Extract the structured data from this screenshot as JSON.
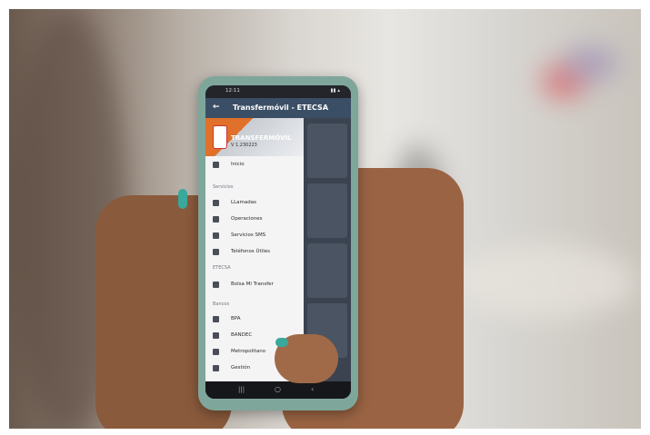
{
  "status_bar": {
    "time": "12:11"
  },
  "app_bar": {
    "title": "Transfermóvil - ETECSA"
  },
  "drawer": {
    "brand": "TRANSFERMÓVIL",
    "version": "V 1.230223",
    "items": {
      "home": "Inicio",
      "section_services": "Servicios",
      "calls": "LLamadas",
      "operations": "Operaciones",
      "sms": "Servicios SMS",
      "phones": "Teléfonos Útiles",
      "section_etecsa": "ETECSA",
      "bolsa": "Bolsa Mi Transfer",
      "section_banks": "Bancos",
      "bpa": "BPA",
      "bandec": "BANDEC",
      "metro": "Metropolitano",
      "gestion": "Gestión"
    }
  },
  "colors": {
    "phone_case": "#7fa69a",
    "app_bar": "#3a4f66",
    "brand_accent": "#e0702a"
  }
}
